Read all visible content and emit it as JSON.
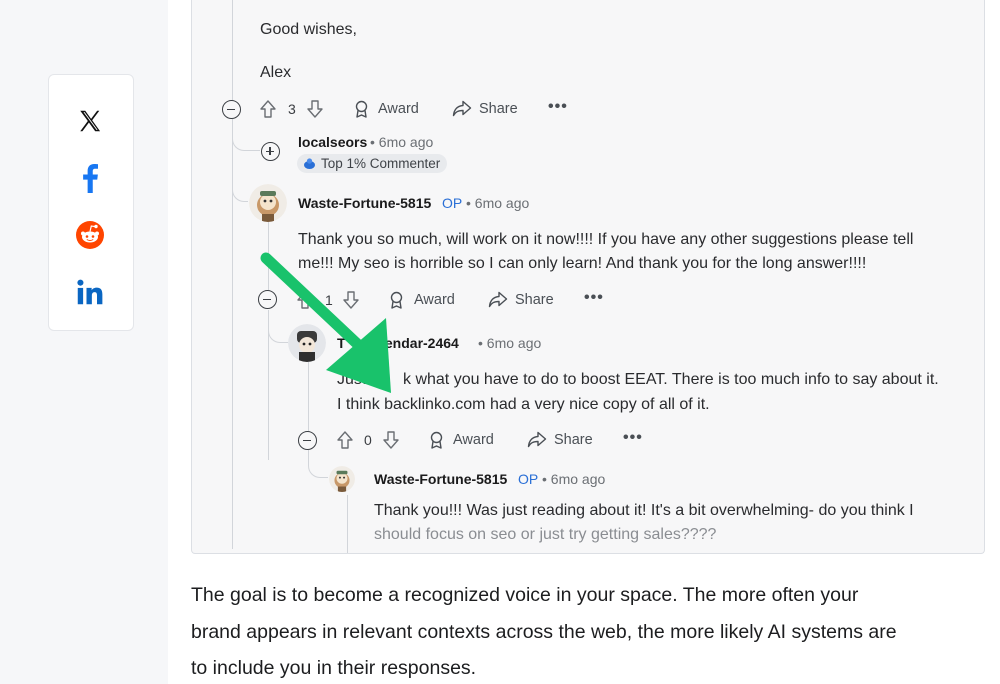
{
  "share_sidebar": {
    "items": [
      {
        "icon": "x-logo-icon",
        "color": "#111111"
      },
      {
        "icon": "facebook-icon",
        "color": "#1877f2"
      },
      {
        "icon": "reddit-icon",
        "color": "#ff4500"
      },
      {
        "icon": "linkedin-icon",
        "color": "#0a66c2"
      }
    ]
  },
  "thread": {
    "c1": {
      "line1": "Good wishes,",
      "line2": "Alex",
      "votes": "3",
      "award": "Award",
      "share": "Share",
      "more": "•••"
    },
    "c2": {
      "username": "localseors",
      "meta": "• 6mo ago",
      "badge": "Top 1% Commenter"
    },
    "c3": {
      "username": "Waste-Fortune-5815",
      "op": "OP",
      "meta": "• 6mo ago",
      "line1": "Thank you so much, will work on it now!!!! If you have any other suggestions please tell",
      "line2": "me!!! My seo is horrible so I can only learn! And thank you for the long answer!!!!",
      "votes": "1",
      "award": "Award",
      "share": "Share",
      "more": "•••"
    },
    "c4": {
      "username": "T",
      "username_tail": "lendar-2464",
      "meta": "• 6mo ago",
      "line1_start": "Just",
      "line1_end": "k what you have to do to boost EEAT. There is too much info to say about it.",
      "line2": "I think backlinko.com had a very nice copy of all of it.",
      "votes": "0",
      "award": "Award",
      "share": "Share",
      "more": "•••"
    },
    "c5": {
      "username": "Waste-Fortune-5815",
      "op": "OP",
      "meta": "• 6mo ago",
      "line1": "Thank you!!! Was just reading about it! It's a bit overwhelming- do you think I",
      "line2": "should focus on seo or just try getting sales????"
    }
  },
  "annotation": {
    "arrow_color": "#19c26b"
  },
  "article": {
    "line1": "The goal is to become a recognized voice in your space. The more often your",
    "line2": "brand appears in relevant contexts across the web, the more likely AI systems are",
    "line3": "to include you in their responses."
  }
}
